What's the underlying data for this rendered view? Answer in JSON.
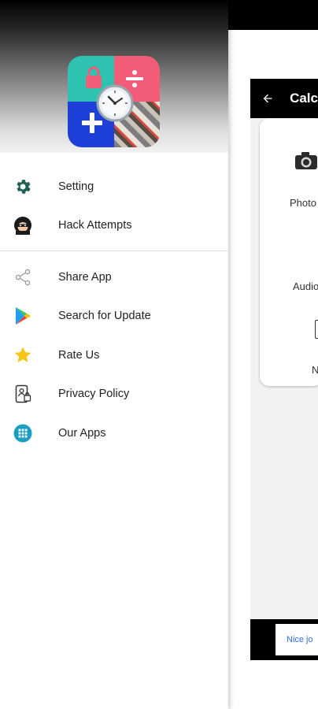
{
  "background_screen": {
    "toolbar_title": "Calc",
    "card_labels": [
      "Photo",
      "Audio",
      "N"
    ],
    "toast_text": "Nice jo"
  },
  "drawer": {
    "logo": "calculator-vault-logo",
    "menu_primary": [
      {
        "label": "Setting",
        "icon": "gear-icon"
      },
      {
        "label": "Hack Attempts",
        "icon": "intruder-icon"
      }
    ],
    "menu_secondary": [
      {
        "label": "Share App",
        "icon": "share-icon"
      },
      {
        "label": "Search for Update",
        "icon": "play-store-icon"
      },
      {
        "label": "Rate Us",
        "icon": "star-icon"
      },
      {
        "label": "Privacy Policy",
        "icon": "privacy-icon"
      },
      {
        "label": "Our Apps",
        "icon": "apps-grid-icon"
      }
    ]
  },
  "colors": {
    "gear": "#1f5f56",
    "star": "#f6c515",
    "apps": "#1c9ec0",
    "logo_teal": "#2dc3b0",
    "logo_pink": "#f25c78",
    "logo_blue": "#1e3fd8"
  }
}
